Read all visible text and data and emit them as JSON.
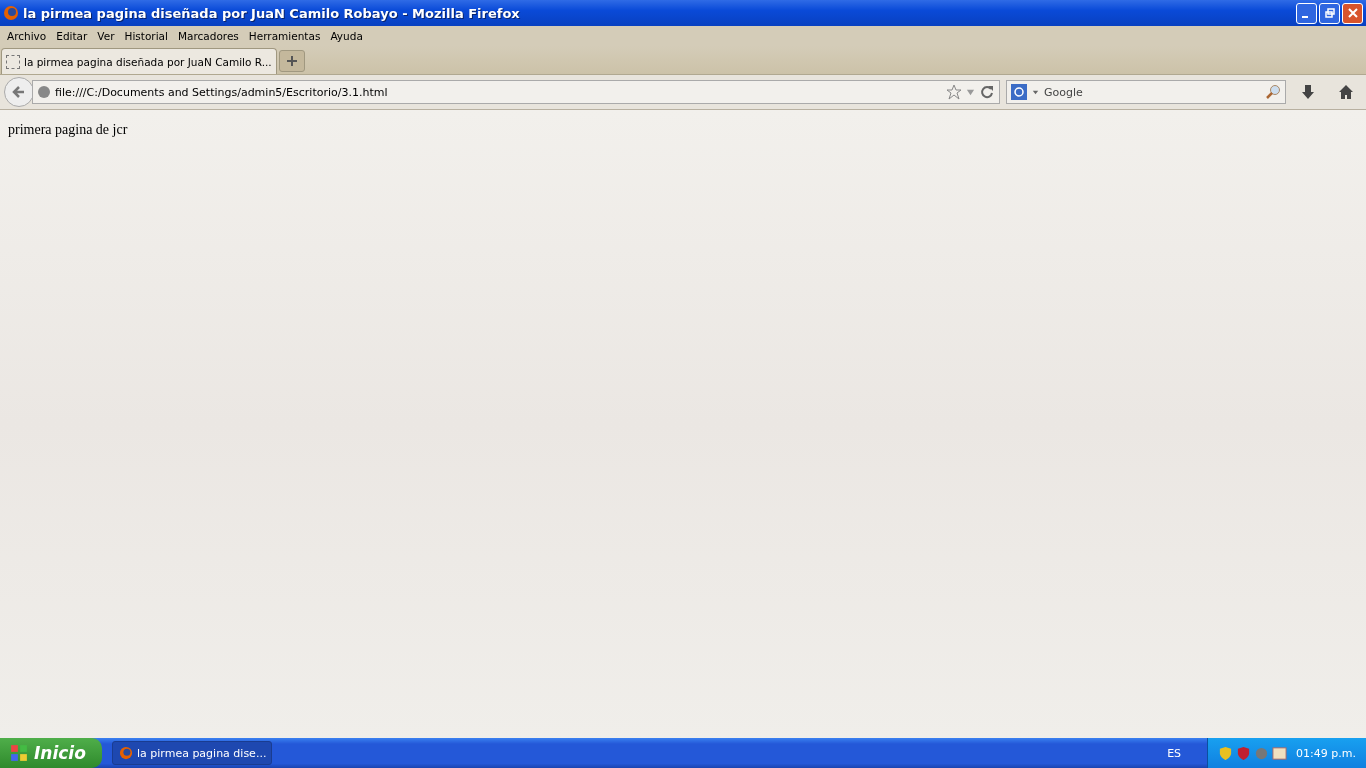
{
  "window": {
    "title": "la pirmea pagina diseñada por JuaN Camilo Robayo - Mozilla Firefox"
  },
  "menu": [
    "Archivo",
    "Editar",
    "Ver",
    "Historial",
    "Marcadores",
    "Herramientas",
    "Ayuda"
  ],
  "tabs": [
    {
      "label": "la pirmea pagina diseñada por JuaN Camilo R...",
      "selected": true
    }
  ],
  "address": {
    "value": "file:///C:/Documents and Settings/admin5/Escritorio/3.1.html"
  },
  "search": {
    "placeholder": "Google"
  },
  "page": {
    "text": "primera pagina de jcr"
  },
  "taskbar": {
    "start": "Inicio",
    "tasks": [
      {
        "label": "la pirmea pagina dise...",
        "selected": true
      }
    ],
    "language": "ES",
    "clock": "01:49 p.m."
  }
}
